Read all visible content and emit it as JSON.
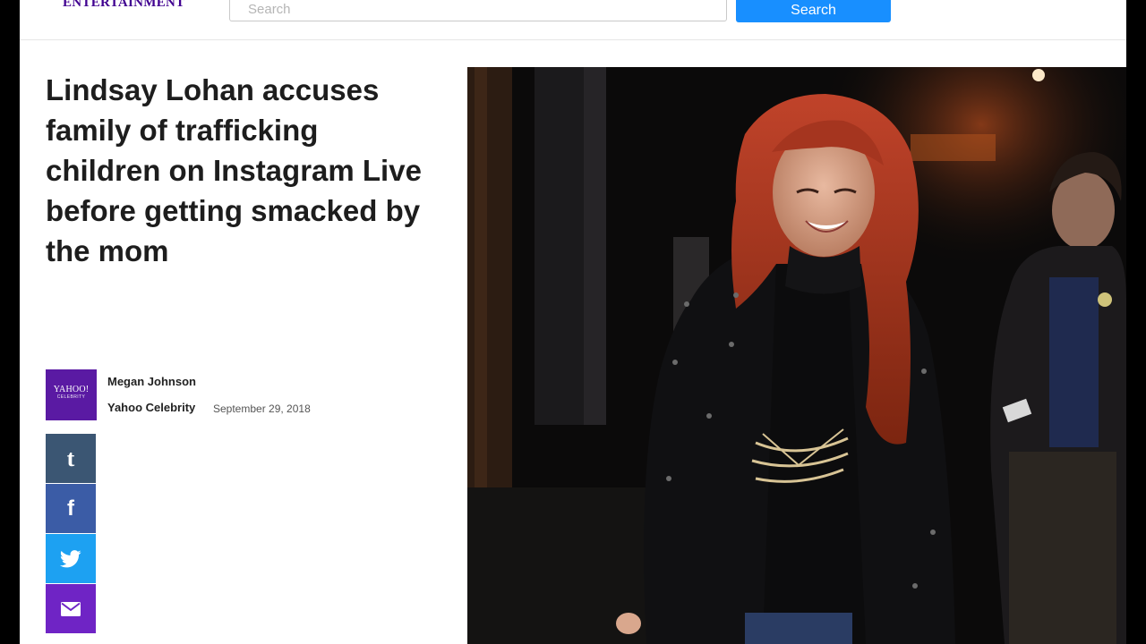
{
  "header": {
    "logo_text": "ENTERTAINMENT",
    "search_placeholder": "Search",
    "search_button": "Search"
  },
  "article": {
    "headline": "Lindsay Lohan accuses family of trafficking children on Instagram Live before getting smacked by the mom",
    "author": "Megan Johnson",
    "source": "Yahoo Celebrity",
    "date": "September 29, 2018",
    "avatar": {
      "line1": "YAHOO!",
      "line2": "CELEBRITY"
    }
  },
  "share": [
    {
      "name": "tumblr",
      "icon": "tumblr-icon"
    },
    {
      "name": "facebook",
      "icon": "facebook-icon"
    },
    {
      "name": "twitter",
      "icon": "twitter-icon"
    },
    {
      "name": "mail",
      "icon": "mail-icon"
    }
  ],
  "colors": {
    "brand_purple": "#400090",
    "search_button": "#188fff",
    "tumblr": "#3b5673",
    "facebook": "#3b5ca6",
    "twitter": "#1da1f2",
    "mail": "#6f24c5"
  }
}
